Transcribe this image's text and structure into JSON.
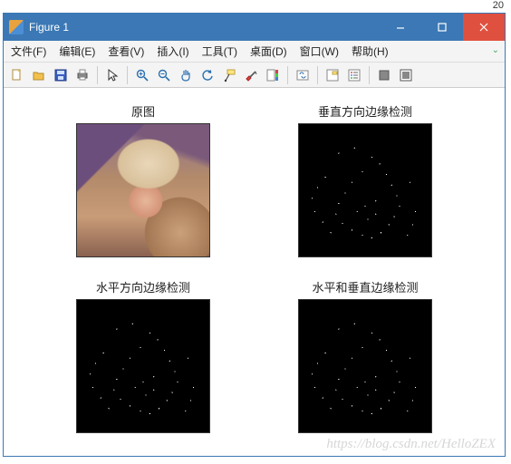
{
  "topcorner": "20",
  "window_title": "Figure 1",
  "menus": [
    "文件(F)",
    "编辑(E)",
    "查看(V)",
    "插入(I)",
    "工具(T)",
    "桌面(D)",
    "窗口(W)",
    "帮助(H)"
  ],
  "toolbar_icons": [
    "new-icon",
    "open-icon",
    "save-icon",
    "print-icon",
    "sep",
    "pointer-icon",
    "sep",
    "zoom-in-icon",
    "zoom-out-icon",
    "pan-icon",
    "rotate-icon",
    "data-cursor-icon",
    "brush-icon",
    "colorbar-icon",
    "sep",
    "link-icon",
    "sep",
    "legend-icon",
    "insert-legend-icon",
    "sep",
    "hide-tools-icon",
    "show-tools-icon"
  ],
  "plots": {
    "tl_title": "原图",
    "tr_title": "垂直方向边缘检测",
    "bl_title": "水平方向边缘检测",
    "br_title": "水平和垂直边缘检测"
  },
  "watermark": "https://blog.csdn.net/HelloZEX"
}
